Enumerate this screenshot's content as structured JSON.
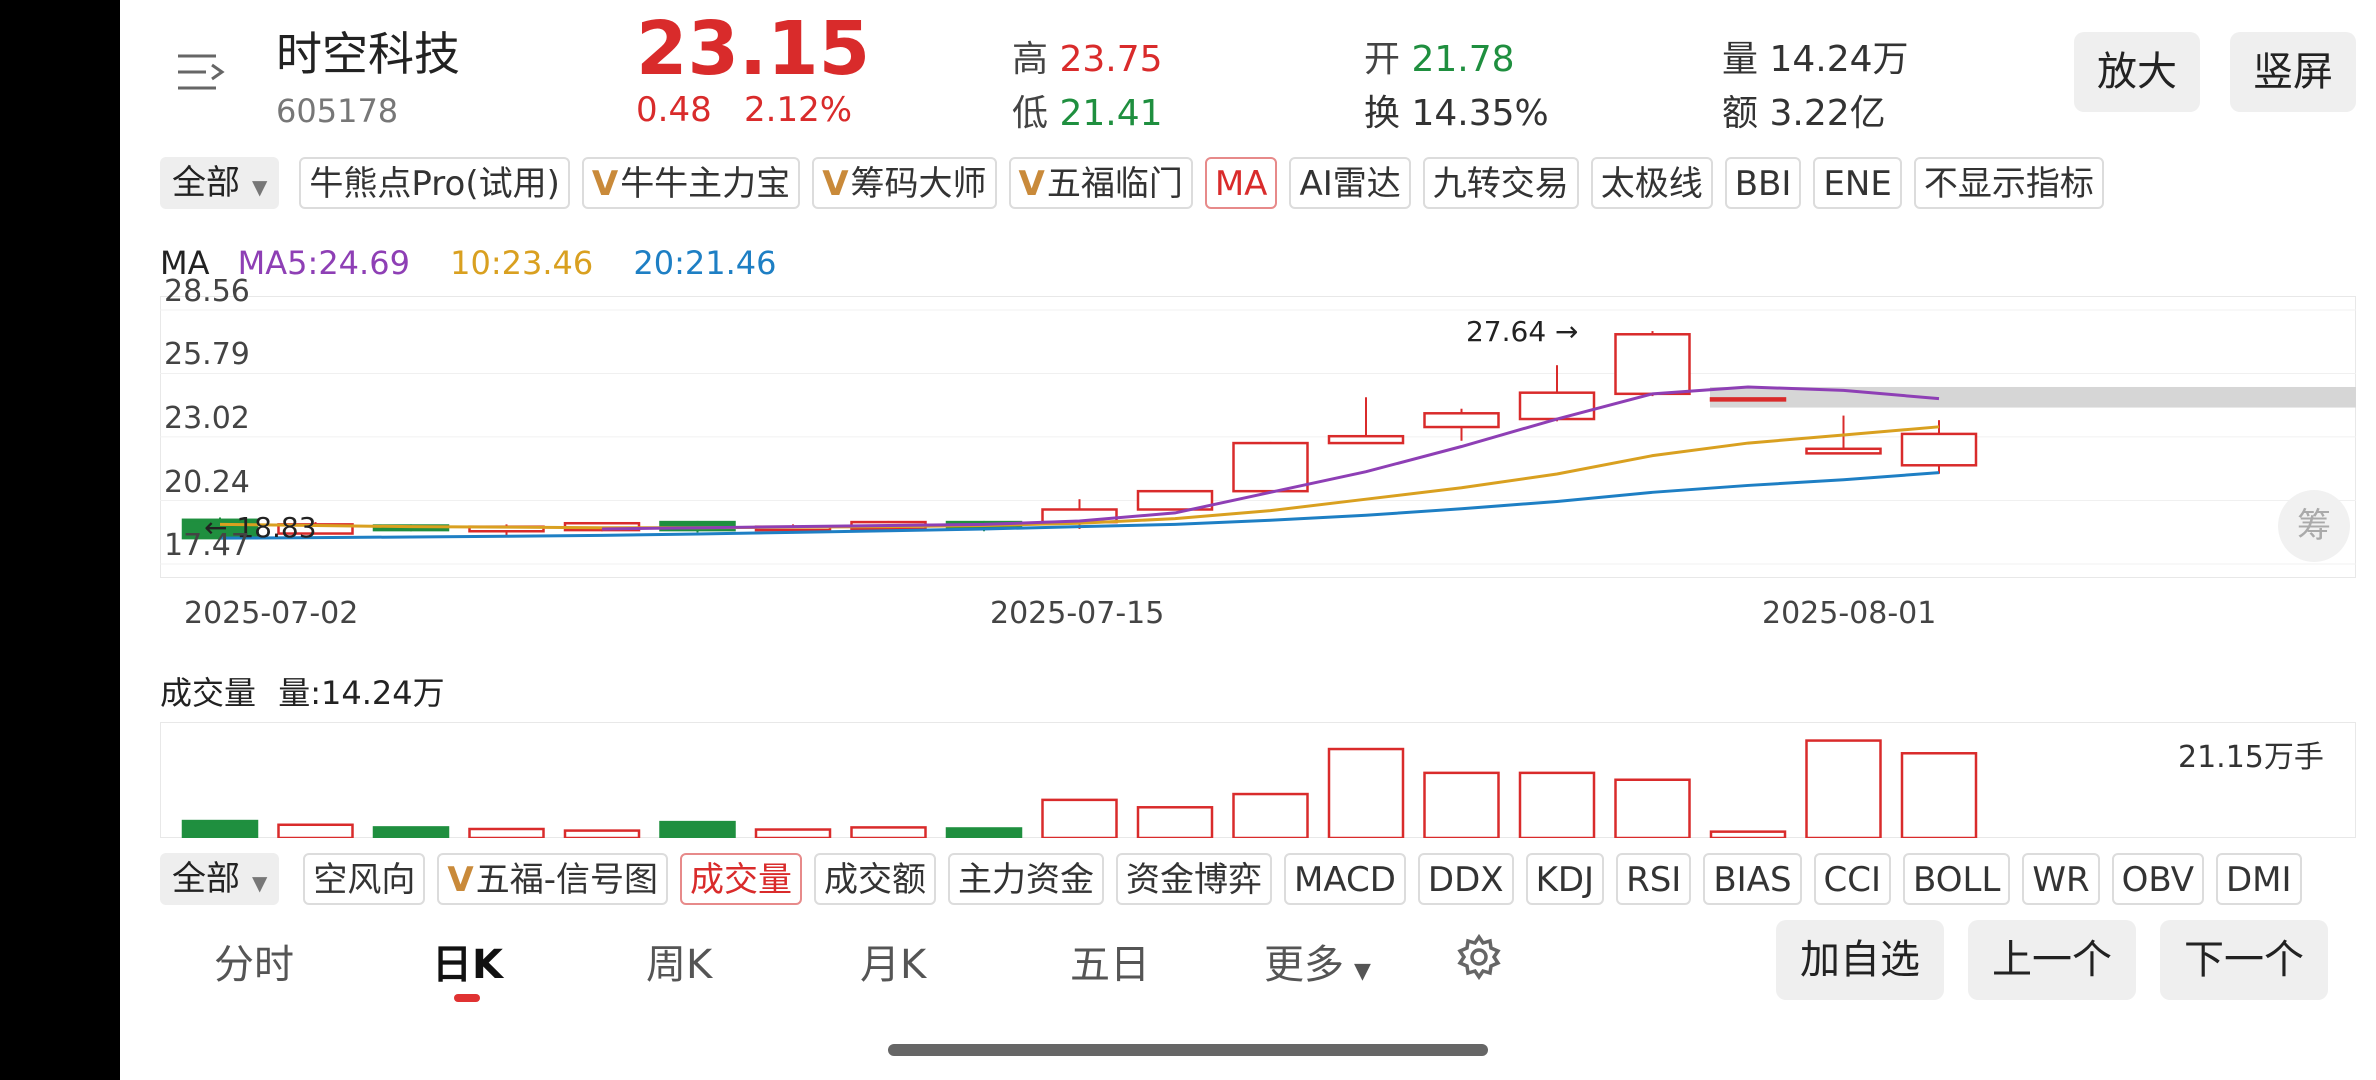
{
  "stock": {
    "name": "时空科技",
    "code": "605178",
    "price": "23.15",
    "change": "0.48",
    "change_pct": "2.12%"
  },
  "stats": {
    "high_label": "高",
    "high": "23.75",
    "low_label": "低",
    "low": "21.41",
    "open_label": "开",
    "open": "21.78",
    "turnover_label": "换",
    "turnover": "14.35%",
    "volume_label": "量",
    "volume": "14.24万",
    "amount_label": "额",
    "amount": "3.22亿"
  },
  "header_buttons": {
    "zoom": "放大",
    "portrait": "竖屏"
  },
  "indicator_bar": {
    "all_label": "全部",
    "chips": [
      {
        "label": "牛熊点Pro(试用)",
        "vip": false,
        "active": false
      },
      {
        "label": "牛牛主力宝",
        "vip": true,
        "active": false
      },
      {
        "label": "筹码大师",
        "vip": true,
        "active": false
      },
      {
        "label": "五福临门",
        "vip": true,
        "active": false
      },
      {
        "label": "MA",
        "vip": false,
        "active": true
      },
      {
        "label": "AI雷达",
        "vip": false,
        "active": false
      },
      {
        "label": "九转交易",
        "vip": false,
        "active": false
      },
      {
        "label": "太极线",
        "vip": false,
        "active": false
      },
      {
        "label": "BBI",
        "vip": false,
        "active": false
      },
      {
        "label": "ENE",
        "vip": false,
        "active": false
      },
      {
        "label": "不显示指标",
        "vip": false,
        "active": false
      }
    ]
  },
  "ma_legend": {
    "title": "MA",
    "ma5": "MA5:24.69",
    "ma10": "10:23.46",
    "ma20": "20:21.46"
  },
  "colors": {
    "up": "#d92b2b",
    "down": "#1f8f3f",
    "ma5": "#8e3fb5",
    "ma10": "#d9a020",
    "ma20": "#1e7fc4"
  },
  "chart_data": {
    "type": "candlestick",
    "y_ticks": [
      "28.56",
      "25.79",
      "23.02",
      "20.24",
      "17.47"
    ],
    "ylim": [
      17.47,
      28.56
    ],
    "x_ticks": [
      "2025-07-02",
      "2025-07-15",
      "2025-08-01"
    ],
    "max_annotation": "27.64",
    "min_annotation": "18.83",
    "candles": [
      {
        "open": 19.4,
        "close": 18.6,
        "high": 19.5,
        "low": 18.6
      },
      {
        "open": 18.8,
        "close": 19.2,
        "high": 19.3,
        "low": 18.8
      },
      {
        "open": 19.15,
        "close": 18.95,
        "high": 19.2,
        "low": 18.9
      },
      {
        "open": 18.9,
        "close": 19.1,
        "high": 19.2,
        "low": 18.7
      },
      {
        "open": 18.95,
        "close": 19.25,
        "high": 19.3,
        "low": 18.9
      },
      {
        "open": 19.3,
        "close": 18.95,
        "high": 19.35,
        "low": 18.85
      },
      {
        "open": 18.95,
        "close": 19.1,
        "high": 19.2,
        "low": 18.8
      },
      {
        "open": 19.0,
        "close": 19.3,
        "high": 19.35,
        "low": 18.95
      },
      {
        "open": 19.3,
        "close": 19.05,
        "high": 19.35,
        "low": 18.9
      },
      {
        "open": 19.3,
        "close": 19.85,
        "high": 20.3,
        "low": 19.0
      },
      {
        "open": 19.85,
        "close": 20.65,
        "high": 20.7,
        "low": 19.85
      },
      {
        "open": 20.65,
        "close": 22.75,
        "high": 22.8,
        "low": 20.65
      },
      {
        "open": 22.75,
        "close": 23.05,
        "high": 24.75,
        "low": 22.75
      },
      {
        "open": 23.45,
        "close": 24.05,
        "high": 24.25,
        "low": 22.85
      },
      {
        "open": 23.8,
        "close": 24.95,
        "high": 26.15,
        "low": 23.7
      },
      {
        "open": 24.9,
        "close": 27.5,
        "high": 27.64,
        "low": 24.8
      },
      {
        "open": 24.7,
        "close": 24.7,
        "high": 24.7,
        "low": 24.7
      },
      {
        "open": 22.3,
        "close": 22.5,
        "high": 23.95,
        "low": 22.3
      },
      {
        "open": 21.78,
        "close": 23.15,
        "high": 23.75,
        "low": 21.41
      }
    ],
    "volume_title": "成交量",
    "volume_value": "量:14.24万",
    "volume_max_label": "21.15万手",
    "volumes": [
      3.2,
      2.5,
      2.0,
      1.7,
      1.4,
      3.0,
      1.6,
      2.0,
      1.8,
      7.2,
      5.8,
      8.3,
      16.8,
      12.3,
      12.3,
      11.0,
      1.2,
      18.4,
      16.0
    ],
    "volume_max": 21.15,
    "ma5": [
      null,
      null,
      null,
      null,
      19.0,
      19.05,
      19.1,
      19.15,
      19.2,
      19.35,
      19.7,
      20.6,
      21.5,
      22.6,
      23.8,
      24.9,
      25.2,
      25.05,
      24.69
    ],
    "ma10": [
      19.2,
      19.15,
      19.1,
      19.08,
      19.05,
      19.05,
      19.08,
      19.1,
      19.15,
      19.25,
      19.45,
      19.8,
      20.3,
      20.8,
      21.4,
      22.2,
      22.75,
      23.1,
      23.46
    ],
    "ma20": [
      18.6,
      18.62,
      18.65,
      18.68,
      18.72,
      18.78,
      18.85,
      18.92,
      19.0,
      19.1,
      19.2,
      19.38,
      19.6,
      19.88,
      20.2,
      20.6,
      20.9,
      21.15,
      21.46
    ]
  },
  "chip_side_label": "筹",
  "sub_indicator_bar": {
    "all_label": "全部",
    "chips": [
      {
        "label": "空风向",
        "vip": false,
        "active": false
      },
      {
        "label": "五福-信号图",
        "vip": true,
        "active": false
      },
      {
        "label": "成交量",
        "vip": false,
        "active": true
      },
      {
        "label": "成交额",
        "vip": false,
        "active": false
      },
      {
        "label": "主力资金",
        "vip": false,
        "active": false
      },
      {
        "label": "资金博弈",
        "vip": false,
        "active": false
      },
      {
        "label": "MACD",
        "vip": false,
        "active": false
      },
      {
        "label": "DDX",
        "vip": false,
        "active": false
      },
      {
        "label": "KDJ",
        "vip": false,
        "active": false
      },
      {
        "label": "RSI",
        "vip": false,
        "active": false
      },
      {
        "label": "BIAS",
        "vip": false,
        "active": false
      },
      {
        "label": "CCI",
        "vip": false,
        "active": false
      },
      {
        "label": "BOLL",
        "vip": false,
        "active": false
      },
      {
        "label": "WR",
        "vip": false,
        "active": false
      },
      {
        "label": "OBV",
        "vip": false,
        "active": false
      },
      {
        "label": "DMI",
        "vip": false,
        "active": false
      }
    ]
  },
  "period_tabs": {
    "intraday": "分时",
    "daily": "日K",
    "weekly": "周K",
    "monthly": "月K",
    "five_day": "五日",
    "more": "更多"
  },
  "bottom_buttons": {
    "add_watch": "加自选",
    "prev": "上一个",
    "next": "下一个"
  }
}
